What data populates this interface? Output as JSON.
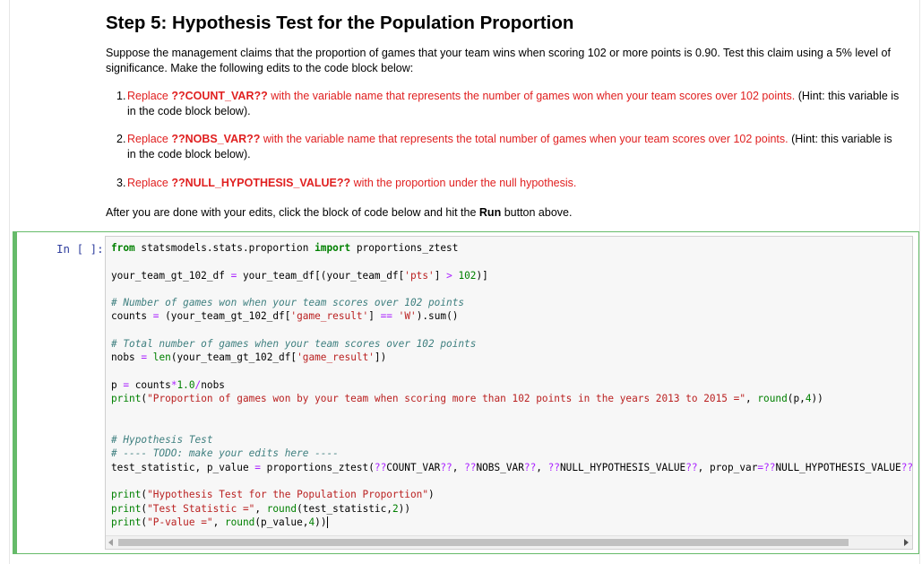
{
  "markdown": {
    "title": "Step 5: Hypothesis Test for the Population Proportion",
    "intro": "Suppose the management claims that the proportion of games that your team wins when scoring 102 or more points is 0.90. Test this claim using a 5% level of significance. Make the following edits to the code block below:",
    "items": [
      {
        "num": "1.",
        "pre": "Replace ",
        "token": "??COUNT_VAR??",
        "red": " with the variable name that represents the number of games won when your team scores over 102 points.",
        "hint": " (Hint: this variable is in the code block below)."
      },
      {
        "num": "2.",
        "pre": "Replace ",
        "token": "??NOBS_VAR??",
        "red": " with the variable name that represents the total number of games when your team scores over 102 points.",
        "hint": " (Hint: this variable is in the code block below)."
      },
      {
        "num": "3.",
        "pre": "Replace ",
        "token": "??NULL_HYPOTHESIS_VALUE??",
        "red": " with the proportion under the null hypothesis.",
        "hint": ""
      }
    ],
    "after_pre": "After you are done with your edits, click the block of code below and hit the ",
    "after_bold": "Run",
    "after_post": " button above."
  },
  "cell": {
    "prompt": "In [ ]:",
    "code_lines": [
      "from statsmodels.stats.proportion import proportions_ztest",
      "",
      "your_team_gt_102_df = your_team_df[(your_team_df['pts'] > 102)]",
      "",
      "# Number of games won when your team scores over 102 points",
      "counts = (your_team_gt_102_df['game_result'] == 'W').sum()",
      "",
      "# Total number of games when your team scores over 102 points",
      "nobs = len(your_team_gt_102_df['game_result'])",
      "",
      "p = counts*1.0/nobs",
      "print(\"Proportion of games won by your team when scoring more than 102 points in the years 2013 to 2015 =\", round(p,4))",
      "",
      "",
      "# Hypothesis Test",
      "# ---- TODO: make your edits here ----",
      "test_statistic, p_value = proportions_ztest(??COUNT_VAR??, ??NOBS_VAR??, ??NULL_HYPOTHESIS_VALUE??, prop_var=??NULL_HYPOTHESIS_VALUE??)",
      "",
      "print(\"Hypothesis Test for the Population Proportion\")",
      "print(\"Test Statistic =\", round(test_statistic,2))",
      "print(\"P-value =\", round(p_value,4))"
    ]
  },
  "colors": {
    "cell_border": "#66bb6a",
    "red_text": "#e02020",
    "keyword": "#008000",
    "string": "#ba2121",
    "comment": "#408080",
    "operator": "#aa22ff",
    "prompt": "#303f9f"
  }
}
